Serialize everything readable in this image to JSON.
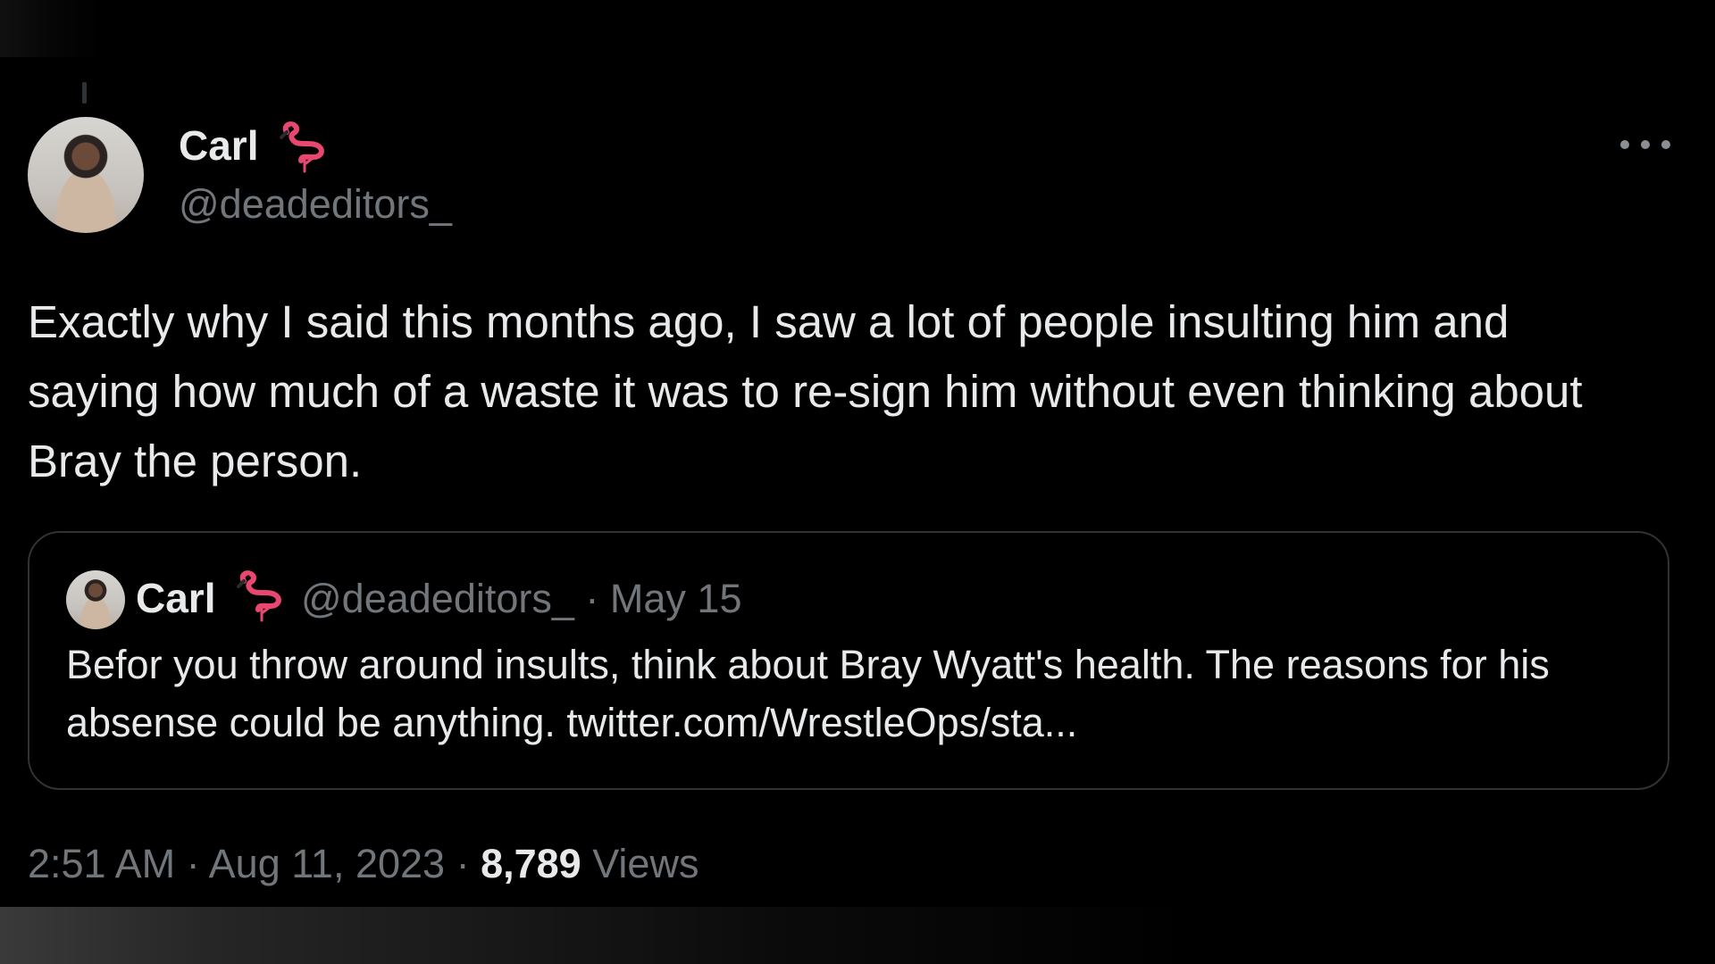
{
  "tweet": {
    "author_name": "Carl",
    "handle": "@deadeditors_",
    "text": "Exactly why I said this months ago, I saw a lot of people insulting him and saying how much of a waste it was to re-sign him without even thinking about Bray the person.",
    "time": "2:51 AM",
    "date": "Aug 11, 2023",
    "view_count": "8,789",
    "views_label": "Views",
    "separator": "·"
  },
  "quoted_tweet": {
    "author_name": "Carl",
    "handle": "@deadeditors_",
    "separator": "·",
    "date": "May 15",
    "text": "Befor you throw around insults, think about Bray Wyatt's health. The reasons for his absense could be anything. twitter.com/WrestleOps/sta..."
  },
  "icons": {
    "badge": "flamingo-icon",
    "menu": "more-options-icon"
  },
  "colors": {
    "background": "#000000",
    "primary_text": "#e7e9ea",
    "secondary_text": "#71767b",
    "border": "#2f3336",
    "flamingo": "#e8476f"
  }
}
